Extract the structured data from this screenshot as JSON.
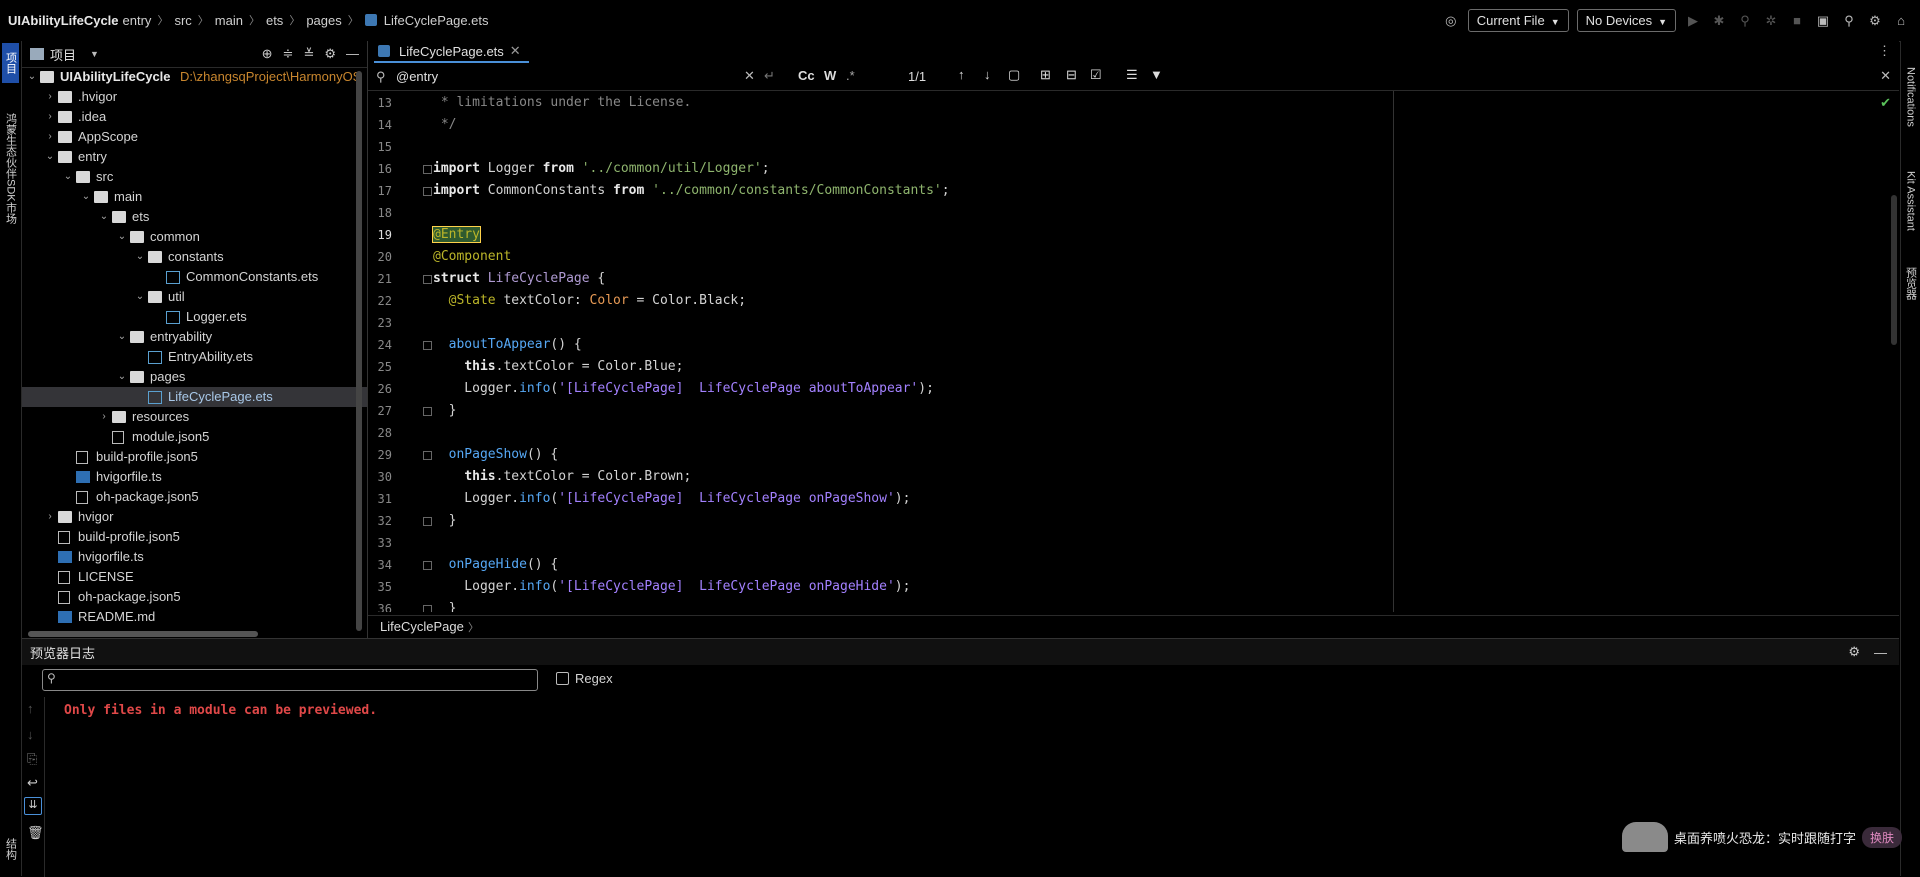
{
  "breadcrumb": [
    "UIAbilityLifeCycle",
    "entry",
    "src",
    "main",
    "ets",
    "pages",
    "LifeCyclePage.ets"
  ],
  "toolbar": {
    "current_file": "Current File",
    "no_devices": "No Devices"
  },
  "left_strip": {
    "project_tab": "项目",
    "sdk_tab": "鸿蒙生态伙伴SDK市场",
    "structure_tab": "结构"
  },
  "right_strip": {
    "notifications": "Notifications",
    "kit_assistant": "Kit Assistant",
    "previewer": "预览器"
  },
  "project_panel": {
    "title": "项目",
    "root_name": "UIAbilityLifeCycle",
    "root_path": "D:\\zhangsqProject\\HarmonyOS",
    "items": [
      {
        "label": ".hvigor",
        "depth": 1,
        "kind": "folder",
        "expanded": false
      },
      {
        "label": ".idea",
        "depth": 1,
        "kind": "folder",
        "expanded": false
      },
      {
        "label": "AppScope",
        "depth": 1,
        "kind": "folder",
        "expanded": false
      },
      {
        "label": "entry",
        "depth": 1,
        "kind": "folder",
        "expanded": true
      },
      {
        "label": "src",
        "depth": 2,
        "kind": "folder",
        "expanded": true
      },
      {
        "label": "main",
        "depth": 3,
        "kind": "folder",
        "expanded": true
      },
      {
        "label": "ets",
        "depth": 4,
        "kind": "folder",
        "expanded": true
      },
      {
        "label": "common",
        "depth": 5,
        "kind": "folder",
        "expanded": true
      },
      {
        "label": "constants",
        "depth": 6,
        "kind": "folder",
        "expanded": true
      },
      {
        "label": "CommonConstants.ets",
        "depth": 7,
        "kind": "ets"
      },
      {
        "label": "util",
        "depth": 6,
        "kind": "folder",
        "expanded": true
      },
      {
        "label": "Logger.ets",
        "depth": 7,
        "kind": "ets"
      },
      {
        "label": "entryability",
        "depth": 5,
        "kind": "folder",
        "expanded": true
      },
      {
        "label": "EntryAbility.ets",
        "depth": 6,
        "kind": "ets"
      },
      {
        "label": "pages",
        "depth": 5,
        "kind": "folder",
        "expanded": true
      },
      {
        "label": "LifeCyclePage.ets",
        "depth": 6,
        "kind": "ets",
        "selected": true
      },
      {
        "label": "resources",
        "depth": 4,
        "kind": "folder",
        "expanded": false
      },
      {
        "label": "module.json5",
        "depth": 4,
        "kind": "file"
      },
      {
        "label": "build-profile.json5",
        "depth": 2,
        "kind": "file"
      },
      {
        "label": "hvigorfile.ts",
        "depth": 2,
        "kind": "ts"
      },
      {
        "label": "oh-package.json5",
        "depth": 2,
        "kind": "file"
      },
      {
        "label": "hvigor",
        "depth": 1,
        "kind": "folder",
        "expanded": false
      },
      {
        "label": "build-profile.json5",
        "depth": 1,
        "kind": "file"
      },
      {
        "label": "hvigorfile.ts",
        "depth": 1,
        "kind": "ts"
      },
      {
        "label": "LICENSE",
        "depth": 1,
        "kind": "file"
      },
      {
        "label": "oh-package.json5",
        "depth": 1,
        "kind": "file"
      },
      {
        "label": "README.md",
        "depth": 1,
        "kind": "md"
      }
    ]
  },
  "editor": {
    "tab_label": "LifeCyclePage.ets",
    "search_value": "@entry",
    "match_count": "1/1",
    "find_opt_cc": "Cc",
    "find_opt_w": "W",
    "find_opt_regex": ".*",
    "current_line": 19,
    "lines": [
      {
        "n": 13,
        "text": " * limitations under the License."
      },
      {
        "n": 14,
        "text": " */"
      },
      {
        "n": 15,
        "text": ""
      },
      {
        "n": 16,
        "text": "import Logger from '../common/util/Logger';"
      },
      {
        "n": 17,
        "text": "import CommonConstants from '../common/constants/CommonConstants';"
      },
      {
        "n": 18,
        "text": ""
      },
      {
        "n": 19,
        "text": "@Entry"
      },
      {
        "n": 20,
        "text": "@Component"
      },
      {
        "n": 21,
        "text": "struct LifeCyclePage {"
      },
      {
        "n": 22,
        "text": "  @State textColor: Color = Color.Black;"
      },
      {
        "n": 23,
        "text": ""
      },
      {
        "n": 24,
        "text": "  aboutToAppear() {"
      },
      {
        "n": 25,
        "text": "    this.textColor = Color.Blue;"
      },
      {
        "n": 26,
        "text": "    Logger.info('[LifeCyclePage]  LifeCyclePage aboutToAppear');"
      },
      {
        "n": 27,
        "text": "  }"
      },
      {
        "n": 28,
        "text": ""
      },
      {
        "n": 29,
        "text": "  onPageShow() {"
      },
      {
        "n": 30,
        "text": "    this.textColor = Color.Brown;"
      },
      {
        "n": 31,
        "text": "    Logger.info('[LifeCyclePage]  LifeCyclePage onPageShow');"
      },
      {
        "n": 32,
        "text": "  }"
      },
      {
        "n": 33,
        "text": ""
      },
      {
        "n": 34,
        "text": "  onPageHide() {"
      },
      {
        "n": 35,
        "text": "    Logger.info('[LifeCyclePage]  LifeCyclePage onPageHide');"
      },
      {
        "n": 36,
        "text": "  }"
      }
    ],
    "structure_crumb": "LifeCyclePage"
  },
  "log_panel": {
    "title": "预览器日志",
    "regex_label": "Regex",
    "message": "Only files in a module can be previewed."
  },
  "toast": {
    "text": "桌面养喷火恐龙：实时跟随打字",
    "button": "换肤"
  },
  "colors": {
    "accent": "#4a90d9",
    "current_line": "#101a5e",
    "error_text": "#e04848"
  }
}
